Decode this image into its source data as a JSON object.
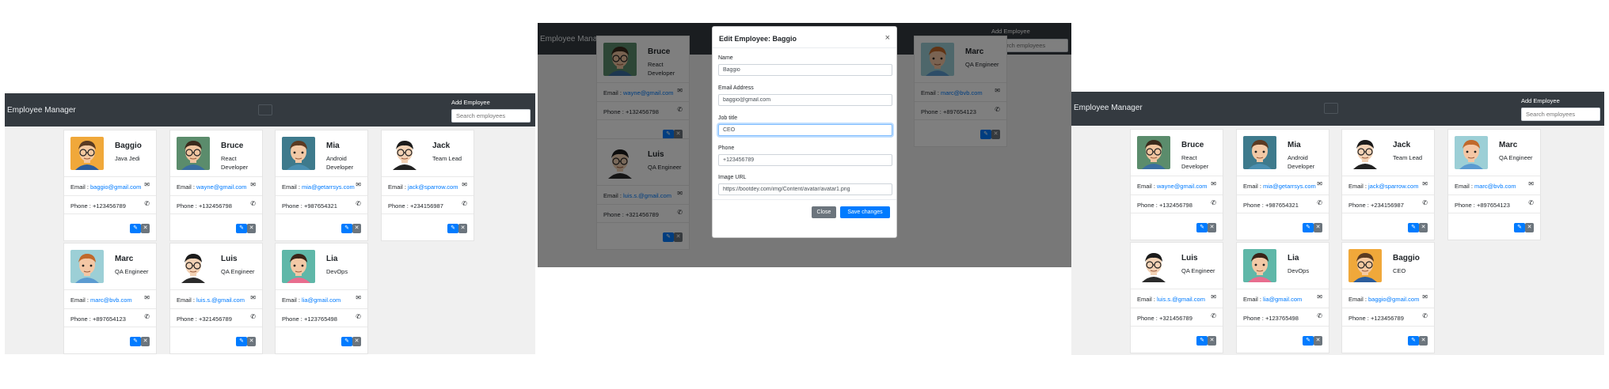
{
  "app": {
    "brand": "Employee Manager",
    "add_employee": "Add Employee",
    "search_placeholder": "Search employees"
  },
  "labels": {
    "email_prefix": "Email : ",
    "phone_prefix": "Phone : "
  },
  "panel1": {
    "cards": [
      {
        "name": "Baggio",
        "job": "Java Jedi",
        "email": "baggio@gmail.com",
        "phone": "+123456789",
        "avatar": "baggio"
      },
      {
        "name": "Bruce",
        "job": "React Developer",
        "email": "wayne@gmail.com",
        "phone": "+132456798",
        "avatar": "bruce"
      },
      {
        "name": "Mia",
        "job": "Android Developer",
        "email": "mia@getarrsys.com",
        "phone": "+987654321",
        "avatar": "mia"
      },
      {
        "name": "Jack",
        "job": "Team Lead",
        "email": "jack@sparrow.com",
        "phone": "+234156987",
        "avatar": "jack"
      },
      {
        "name": "Marc",
        "job": "QA Engineer",
        "email": "marc@bvb.com",
        "phone": "+897654123",
        "avatar": "marc"
      },
      {
        "name": "Luis",
        "job": "QA Engineer",
        "email": "luis.s.@gmail.com",
        "phone": "+321456789",
        "avatar": "luis"
      },
      {
        "name": "Lia",
        "job": "DevOps",
        "email": "lia@gmail.com",
        "phone": "+123765498",
        "avatar": "lia"
      }
    ]
  },
  "panel2": {
    "cards": [
      {
        "name": "Bruce",
        "job": "React Developer",
        "email": "wayne@gmail.com",
        "phone": "+132456798",
        "avatar": "bruce"
      },
      {
        "name": "Marc",
        "job": "QA Engineer",
        "email": "marc@bvb.com",
        "phone": "+897654123",
        "avatar": "marc"
      },
      {
        "name": "Luis",
        "job": "QA Engineer",
        "email": "luis.s.@gmail.com",
        "phone": "+321456789",
        "avatar": "luis"
      }
    ],
    "modal": {
      "title": "Edit Employee: Baggio",
      "close_icon": "×",
      "name_label": "Name",
      "name_value": "Baggio",
      "email_label": "Email Address",
      "email_value": "baggio@gmail.com",
      "job_label": "Job title",
      "job_value": "CEO",
      "phone_label": "Phone",
      "phone_value": "+123456789",
      "image_label": "Image URL",
      "image_value": "https://bootdey.com/img/Content/avatar/avatar1.png",
      "close_button": "Close",
      "save_button": "Save changes"
    }
  },
  "panel3": {
    "cards": [
      {
        "name": "Bruce",
        "job": "React Developer",
        "email": "wayne@gmail.com",
        "phone": "+132456798",
        "avatar": "bruce"
      },
      {
        "name": "Mia",
        "job": "Android Developer",
        "email": "mia@getarrsys.com",
        "phone": "+987654321",
        "avatar": "mia"
      },
      {
        "name": "Jack",
        "job": "Team Lead",
        "email": "jack@sparrow.com",
        "phone": "+234156987",
        "avatar": "jack"
      },
      {
        "name": "Marc",
        "job": "QA Engineer",
        "email": "marc@bvb.com",
        "phone": "+897654123",
        "avatar": "marc"
      },
      {
        "name": "Luis",
        "job": "QA Engineer",
        "email": "luis.s.@gmail.com",
        "phone": "+321456789",
        "avatar": "luis"
      },
      {
        "name": "Lia",
        "job": "DevOps",
        "email": "lia@gmail.com",
        "phone": "+123765498",
        "avatar": "lia"
      },
      {
        "name": "Baggio",
        "job": "CEO",
        "email": "baggio@gmail.com",
        "phone": "+123456789",
        "avatar": "baggio"
      }
    ]
  },
  "icons": {
    "email": "envelope-icon",
    "phone": "phone-icon",
    "edit": "pencil-icon",
    "delete": "x-icon"
  },
  "colors": {
    "navbar": "#343a40",
    "primary": "#007bff",
    "secondary": "#6c757d"
  }
}
